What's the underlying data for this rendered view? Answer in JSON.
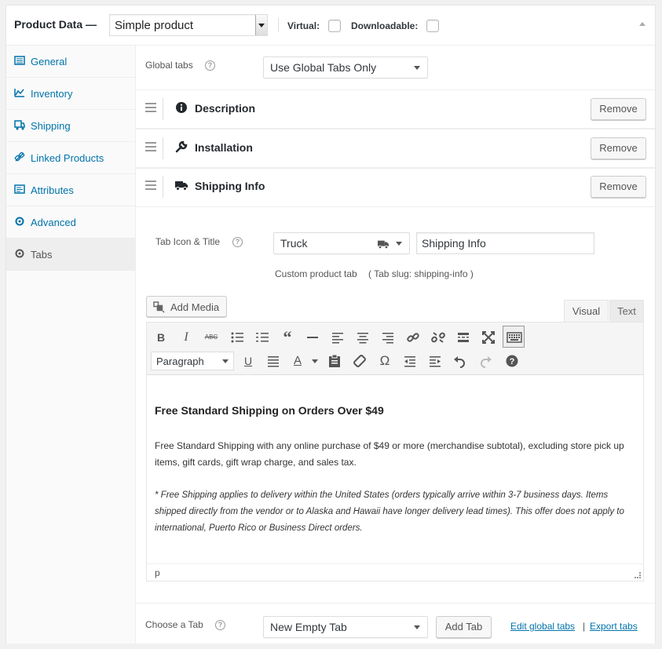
{
  "header": {
    "title": "Product Data —",
    "product_type": "Simple product",
    "virtual_label": "Virtual:",
    "downloadable_label": "Downloadable:"
  },
  "sidebar": {
    "items": [
      {
        "label": "General",
        "icon": "general-icon"
      },
      {
        "label": "Inventory",
        "icon": "inventory-icon"
      },
      {
        "label": "Shipping",
        "icon": "shipping-icon"
      },
      {
        "label": "Linked Products",
        "icon": "link-icon"
      },
      {
        "label": "Attributes",
        "icon": "attributes-icon"
      },
      {
        "label": "Advanced",
        "icon": "gear-icon"
      },
      {
        "label": "Tabs",
        "icon": "gear-icon"
      }
    ],
    "active": "Tabs"
  },
  "global_tabs": {
    "label": "Global tabs",
    "value": "Use Global Tabs Only"
  },
  "tabs": [
    {
      "name": "Description",
      "icon": "info-icon",
      "remove_label": "Remove"
    },
    {
      "name": "Installation",
      "icon": "wrench-icon",
      "remove_label": "Remove"
    },
    {
      "name": "Shipping Info",
      "icon": "truck-icon",
      "remove_label": "Remove"
    }
  ],
  "tab_edit": {
    "icon_title_label": "Tab Icon & Title",
    "icon_value": "Truck",
    "title_value": "Shipping Info",
    "custom_note": "Custom product tab",
    "slug_note": "( Tab slug: shipping-info )"
  },
  "editor": {
    "add_media": "Add Media",
    "visual_tab": "Visual",
    "text_tab": "Text",
    "format_value": "Paragraph",
    "heading": "Free Standard Shipping on Orders Over $49",
    "para1": "Free Standard Shipping with any online purchase of $49 or more (merchandise subtotal), excluding store pick up items, gift cards, gift wrap charge, and sales tax.",
    "para2": "* Free Shipping applies to delivery within the United States (orders typically arrive within 3-7 business days. Items shipped directly from the vendor or to Alaska and Hawaii have longer delivery lead times). This offer does not apply to international, Puerto Rico or Business Direct orders.",
    "path": "p"
  },
  "footer": {
    "choose_label": "Choose a Tab",
    "choose_value": "New Empty Tab",
    "add_tab": "Add Tab",
    "edit_global": "Edit global tabs",
    "separator": "|",
    "export": "Export tabs"
  },
  "colors": {
    "link": "#0073aa",
    "text": "#23282d",
    "border": "#e5e5e5"
  }
}
